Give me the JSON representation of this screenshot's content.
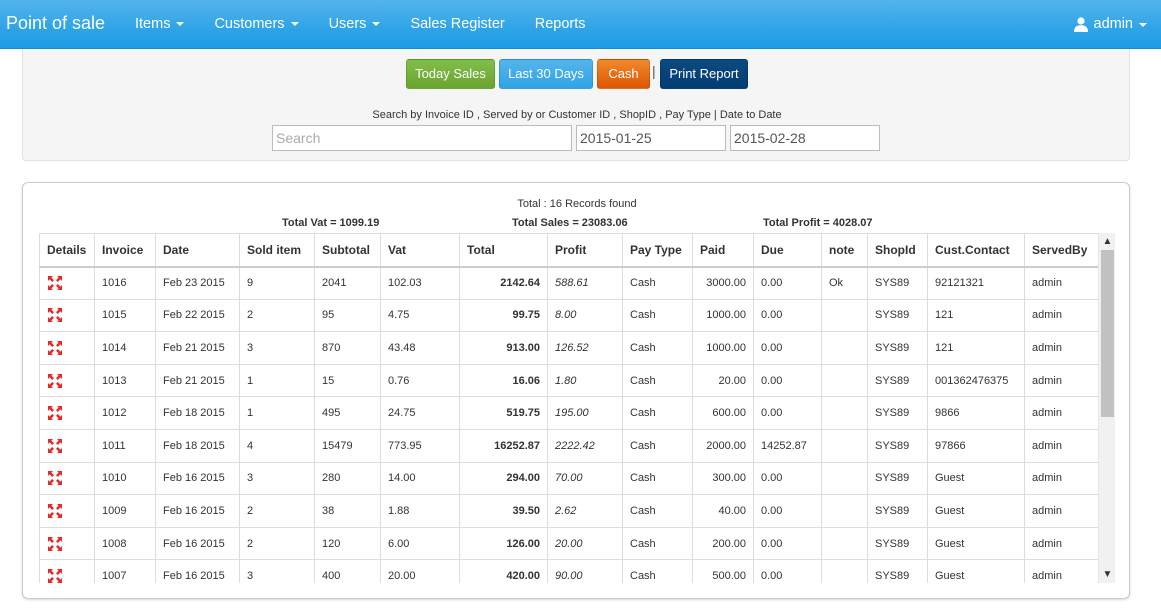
{
  "nav": {
    "brand": "Point of sale",
    "items": [
      {
        "label": "Items",
        "dropdown": true
      },
      {
        "label": "Customers",
        "dropdown": true
      },
      {
        "label": "Users",
        "dropdown": true
      },
      {
        "label": "Sales Register",
        "dropdown": false
      },
      {
        "label": "Reports",
        "dropdown": false
      }
    ],
    "user": "admin"
  },
  "filters": {
    "buttons": {
      "today": "Today Sales",
      "last30": "Last 30 Days",
      "cash": "Cash",
      "separator": "|",
      "print": "Print Report"
    },
    "search_hint": "Search by Invoice ID , Served by or Customer ID , ShopID , Pay Type | Date to Date",
    "search_placeholder": "Search",
    "date_from": "2015-01-25",
    "date_to": "2015-02-28"
  },
  "summary": {
    "records": "Total : 16 Records found",
    "total_vat": "Total Vat = 1099.19",
    "total_sales": "Total Sales = 23083.06",
    "total_profit": "Total Profit = 4028.07"
  },
  "table": {
    "columns": [
      "Details",
      "Invoice",
      "Date",
      "Sold item",
      "Subtotal",
      "Vat",
      "Total",
      "Profit",
      "Pay Type",
      "Paid",
      "Due",
      "note",
      "ShopId",
      "Cust.Contact",
      "ServedBy"
    ],
    "rows": [
      [
        "",
        "1016",
        "Feb 23 2015",
        "9",
        "2041",
        "102.03",
        "2142.64",
        "588.61",
        "Cash",
        "3000.00",
        "0.00",
        "Ok",
        "SYS89",
        "92121321",
        "admin"
      ],
      [
        "",
        "1015",
        "Feb 22 2015",
        "2",
        "95",
        "4.75",
        "99.75",
        "8.00",
        "Cash",
        "1000.00",
        "0.00",
        "",
        "SYS89",
        "121",
        "admin"
      ],
      [
        "",
        "1014",
        "Feb 21 2015",
        "3",
        "870",
        "43.48",
        "913.00",
        "126.52",
        "Cash",
        "1000.00",
        "0.00",
        "",
        "SYS89",
        "121",
        "admin"
      ],
      [
        "",
        "1013",
        "Feb 21 2015",
        "1",
        "15",
        "0.76",
        "16.06",
        "1.80",
        "Cash",
        "20.00",
        "0.00",
        "",
        "SYS89",
        "001362476375",
        "admin"
      ],
      [
        "",
        "1012",
        "Feb 18 2015",
        "1",
        "495",
        "24.75",
        "519.75",
        "195.00",
        "Cash",
        "600.00",
        "0.00",
        "",
        "SYS89",
        "9866",
        "admin"
      ],
      [
        "",
        "1011",
        "Feb 18 2015",
        "4",
        "15479",
        "773.95",
        "16252.87",
        "2222.42",
        "Cash",
        "2000.00",
        "14252.87",
        "",
        "SYS89",
        "97866",
        "admin"
      ],
      [
        "",
        "1010",
        "Feb 16 2015",
        "3",
        "280",
        "14.00",
        "294.00",
        "70.00",
        "Cash",
        "300.00",
        "0.00",
        "",
        "SYS89",
        "Guest",
        "admin"
      ],
      [
        "",
        "1009",
        "Feb 16 2015",
        "2",
        "38",
        "1.88",
        "39.50",
        "2.62",
        "Cash",
        "40.00",
        "0.00",
        "",
        "SYS89",
        "Guest",
        "admin"
      ],
      [
        "",
        "1008",
        "Feb 16 2015",
        "2",
        "120",
        "6.00",
        "126.00",
        "20.00",
        "Cash",
        "200.00",
        "0.00",
        "",
        "SYS89",
        "Guest",
        "admin"
      ],
      [
        "",
        "1007",
        "Feb 16 2015",
        "3",
        "400",
        "20.00",
        "420.00",
        "90.00",
        "Cash",
        "500.00",
        "0.00",
        "",
        "SYS89",
        "Guest",
        "admin"
      ]
    ]
  },
  "icons": {
    "details": "expand-icon",
    "user": "user-icon",
    "caret": "caret-down-icon"
  },
  "colors": {
    "navbar": "#2fa4e7",
    "today_button": "#73a839",
    "last30_button": "#2fa4e7",
    "cash_button": "#dd5600",
    "print_button": "#033c73",
    "expand_icon": "#e32b2b"
  }
}
